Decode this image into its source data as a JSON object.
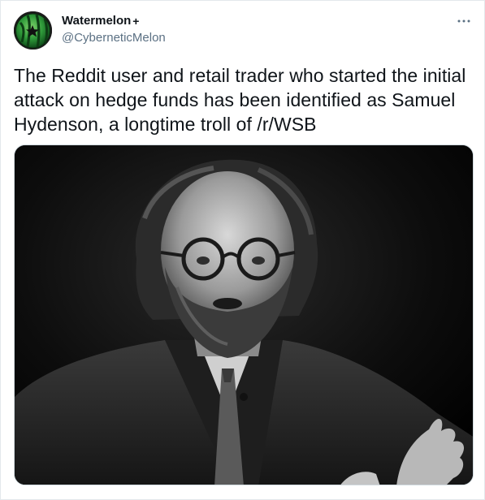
{
  "tweet": {
    "author": {
      "display_name": "Watermelon",
      "name_suffix": "+",
      "handle": "@CyberneticMelon",
      "avatar_icon": "watermelon-avatar"
    },
    "more_label": "···",
    "text": "The Reddit user and retail trader who started the initial attack on hedge funds has been identified as Samuel Hydenson, a longtime troll of /r/WSB",
    "media": {
      "kind": "photo",
      "description_icon": "bearded-man-with-glasses-photo"
    }
  },
  "colors": {
    "text_primary": "#0f1419",
    "text_secondary": "#5b7083",
    "border": "#e3e8ec",
    "media_border": "#cfd9de"
  }
}
